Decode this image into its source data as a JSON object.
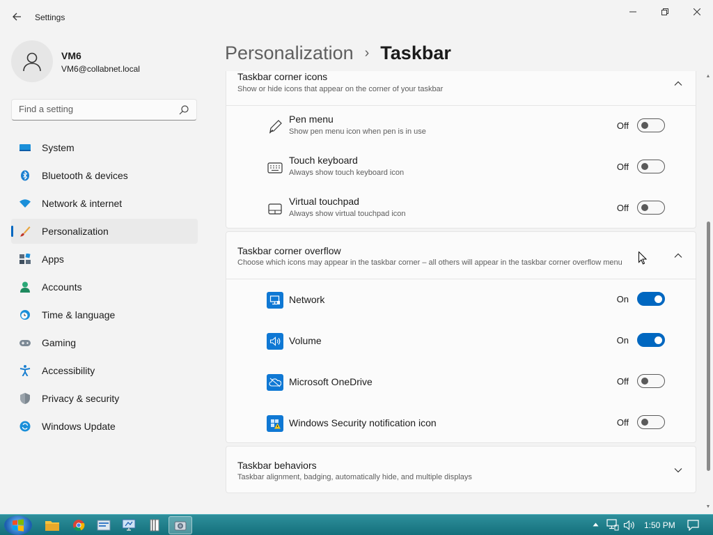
{
  "window": {
    "title": "Settings",
    "back_icon": "back-arrow-icon",
    "controls": [
      "minimize",
      "restore",
      "close"
    ]
  },
  "profile": {
    "name": "VM6",
    "email": "VM6@collabnet.local"
  },
  "search": {
    "placeholder": "Find a setting"
  },
  "sidebar": {
    "items": [
      {
        "label": "System",
        "icon": "system-icon",
        "selected": false
      },
      {
        "label": "Bluetooth & devices",
        "icon": "bluetooth-icon",
        "selected": false
      },
      {
        "label": "Network & internet",
        "icon": "wifi-icon",
        "selected": false
      },
      {
        "label": "Personalization",
        "icon": "brush-icon",
        "selected": true
      },
      {
        "label": "Apps",
        "icon": "apps-icon",
        "selected": false
      },
      {
        "label": "Accounts",
        "icon": "person-icon",
        "selected": false
      },
      {
        "label": "Time & language",
        "icon": "clock-globe-icon",
        "selected": false
      },
      {
        "label": "Gaming",
        "icon": "gamepad-icon",
        "selected": false
      },
      {
        "label": "Accessibility",
        "icon": "accessibility-icon",
        "selected": false
      },
      {
        "label": "Privacy & security",
        "icon": "shield-icon",
        "selected": false
      },
      {
        "label": "Windows Update",
        "icon": "update-icon",
        "selected": false
      }
    ]
  },
  "header": {
    "parent": "Personalization",
    "separator": "›",
    "current": "Taskbar"
  },
  "corner_icons": {
    "title": "Taskbar corner icons",
    "description": "Show or hide icons that appear on the corner of your taskbar",
    "expanded": true,
    "items": [
      {
        "title": "Pen menu",
        "subtitle": "Show pen menu icon when pen is in use",
        "state": "Off",
        "on": false,
        "icon": "pen-icon"
      },
      {
        "title": "Touch keyboard",
        "subtitle": "Always show touch keyboard icon",
        "state": "Off",
        "on": false,
        "icon": "keyboard-icon"
      },
      {
        "title": "Virtual touchpad",
        "subtitle": "Always show virtual touchpad icon",
        "state": "Off",
        "on": false,
        "icon": "touchpad-icon"
      }
    ]
  },
  "corner_overflow": {
    "title": "Taskbar corner overflow",
    "description": "Choose which icons may appear in the taskbar corner – all others will appear in the taskbar corner overflow menu",
    "expanded": true,
    "items": [
      {
        "title": "Network",
        "state": "On",
        "on": true,
        "icon": "network-app-icon"
      },
      {
        "title": "Volume",
        "state": "On",
        "on": true,
        "icon": "volume-app-icon"
      },
      {
        "title": "Microsoft OneDrive",
        "state": "Off",
        "on": false,
        "icon": "onedrive-app-icon"
      },
      {
        "title": "Windows Security notification icon",
        "state": "Off",
        "on": false,
        "icon": "security-app-icon"
      }
    ]
  },
  "behaviors": {
    "title": "Taskbar behaviors",
    "description": "Taskbar alignment, badging, automatically hide, and multiple displays",
    "expanded": false
  },
  "taskbar": {
    "pinned": [
      "explorer-icon",
      "chrome-icon",
      "settings-app-icon",
      "remote-desktop-icon",
      "notepad-icon",
      "camera-icon"
    ],
    "active": "camera-icon",
    "tray": [
      "show-hidden-icon",
      "network-tray-icon",
      "volume-tray-icon"
    ],
    "clock": "1:50 PM",
    "notification_icon": "notification-icon"
  },
  "colors": {
    "accent": "#0067c0",
    "taskbar": "#14707c"
  }
}
